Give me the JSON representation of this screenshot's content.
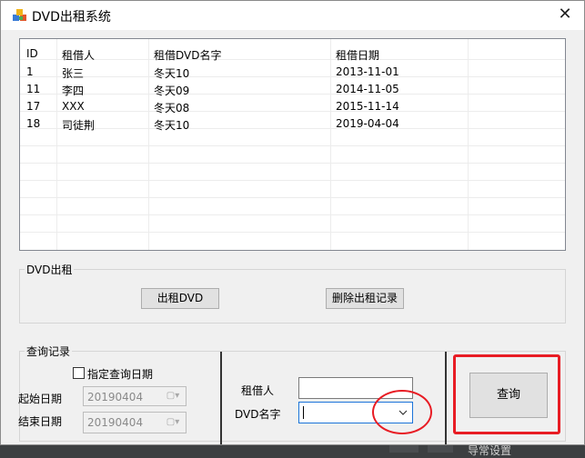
{
  "window": {
    "title": "DVD出租系统",
    "close_glyph": "✕",
    "app_icon": "app-icon"
  },
  "table": {
    "columns": [
      "ID",
      "租借人",
      "租借DVD名字",
      "租借日期"
    ],
    "rows": [
      [
        "1",
        "张三",
        "冬天10",
        "2013-11-01"
      ],
      [
        "11",
        "李四",
        "冬天09",
        "2014-11-05"
      ],
      [
        "17",
        "XXX",
        "冬天08",
        "2015-11-14"
      ],
      [
        "18",
        "司徒荆",
        "冬天10",
        "2019-04-04"
      ]
    ]
  },
  "rent_group": {
    "title": "DVD出租",
    "rent_button": "出租DVD",
    "delete_button": "删除出租记录"
  },
  "query_group": {
    "title": "查询记录",
    "checkbox_label": "指定查询日期",
    "checkbox_checked": false,
    "start_label": "起始日期",
    "start_value": "20190404",
    "end_label": "结束日期",
    "end_value": "20190404",
    "renter_label": "租借人",
    "renter_value": "",
    "dvd_label": "DVD名字",
    "dvd_value": "",
    "query_button": "查询"
  },
  "background_text": "导常设置",
  "colors": {
    "annotation": "#e81c24",
    "focus": "#1a73d9"
  }
}
